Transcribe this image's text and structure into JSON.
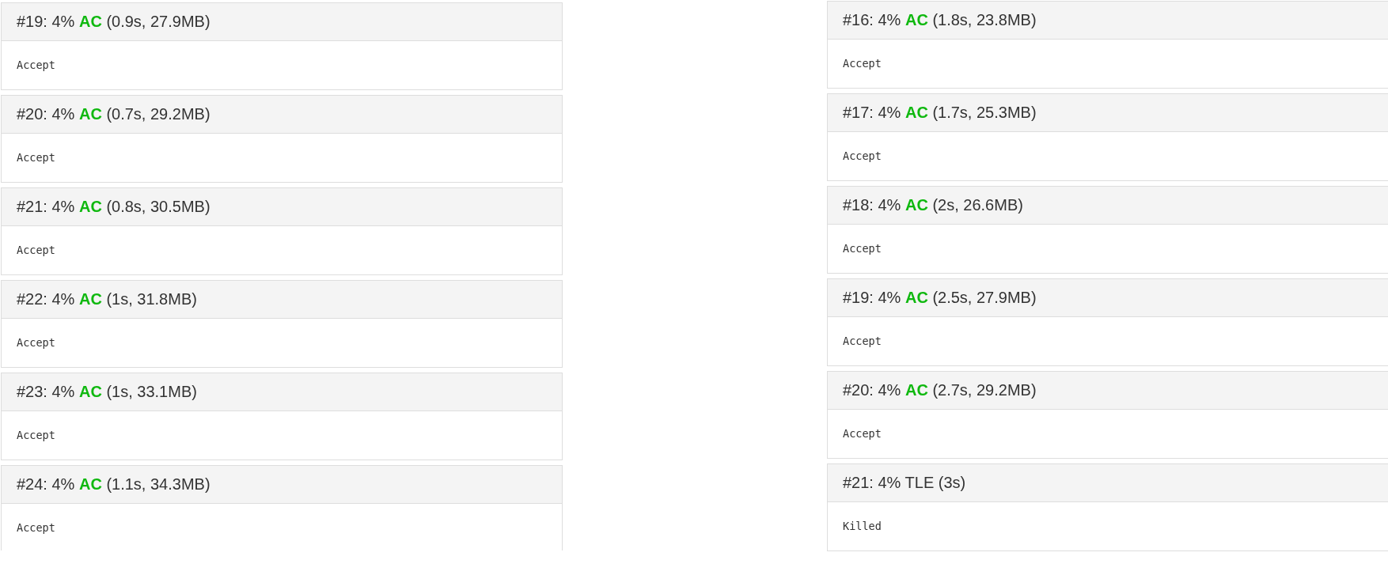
{
  "columns": [
    {
      "results": [
        {
          "title": "#19: 4% **AC** (0.9s, 27.9MB)",
          "kind": "accepted",
          "message": "Accept"
        },
        {
          "title": "#20: 4% **AC** (0.7s, 29.2MB)",
          "kind": "accepted",
          "message": "Accept"
        },
        {
          "title": "#21: 4% **AC** (0.8s, 30.5MB)",
          "kind": "accepted",
          "message": "Accept"
        },
        {
          "title": "#22: 4% **AC** (1s, 31.8MB)",
          "kind": "accepted",
          "message": "Accept"
        },
        {
          "title": "#23: 4% **AC** (1s, 33.1MB)",
          "kind": "accepted",
          "message": "Accept"
        },
        {
          "title": "#24: 4% **AC** (1.1s, 34.3MB)",
          "kind": "accepted",
          "message": "Accept"
        }
      ]
    },
    {
      "results": [
        {
          "title": "#16: 4% **AC** (1.8s, 23.8MB)",
          "kind": "accepted",
          "message": "Accept"
        },
        {
          "title": "#17: 4% **AC** (1.7s, 25.3MB)",
          "kind": "accepted",
          "message": "Accept"
        },
        {
          "title": "#18: 4% **AC** (2s, 26.6MB)",
          "kind": "accepted",
          "message": "Accept"
        },
        {
          "title": "#19: 4% **AC** (2.5s, 27.9MB)",
          "kind": "accepted",
          "message": "Accept"
        },
        {
          "title": "#20: 4% **AC** (2.7s, 29.2MB)",
          "kind": "accepted",
          "message": "Accept"
        },
        {
          "title": "#21: 4% TLE (3s)",
          "kind": "failed",
          "message": "Killed"
        }
      ]
    }
  ]
}
